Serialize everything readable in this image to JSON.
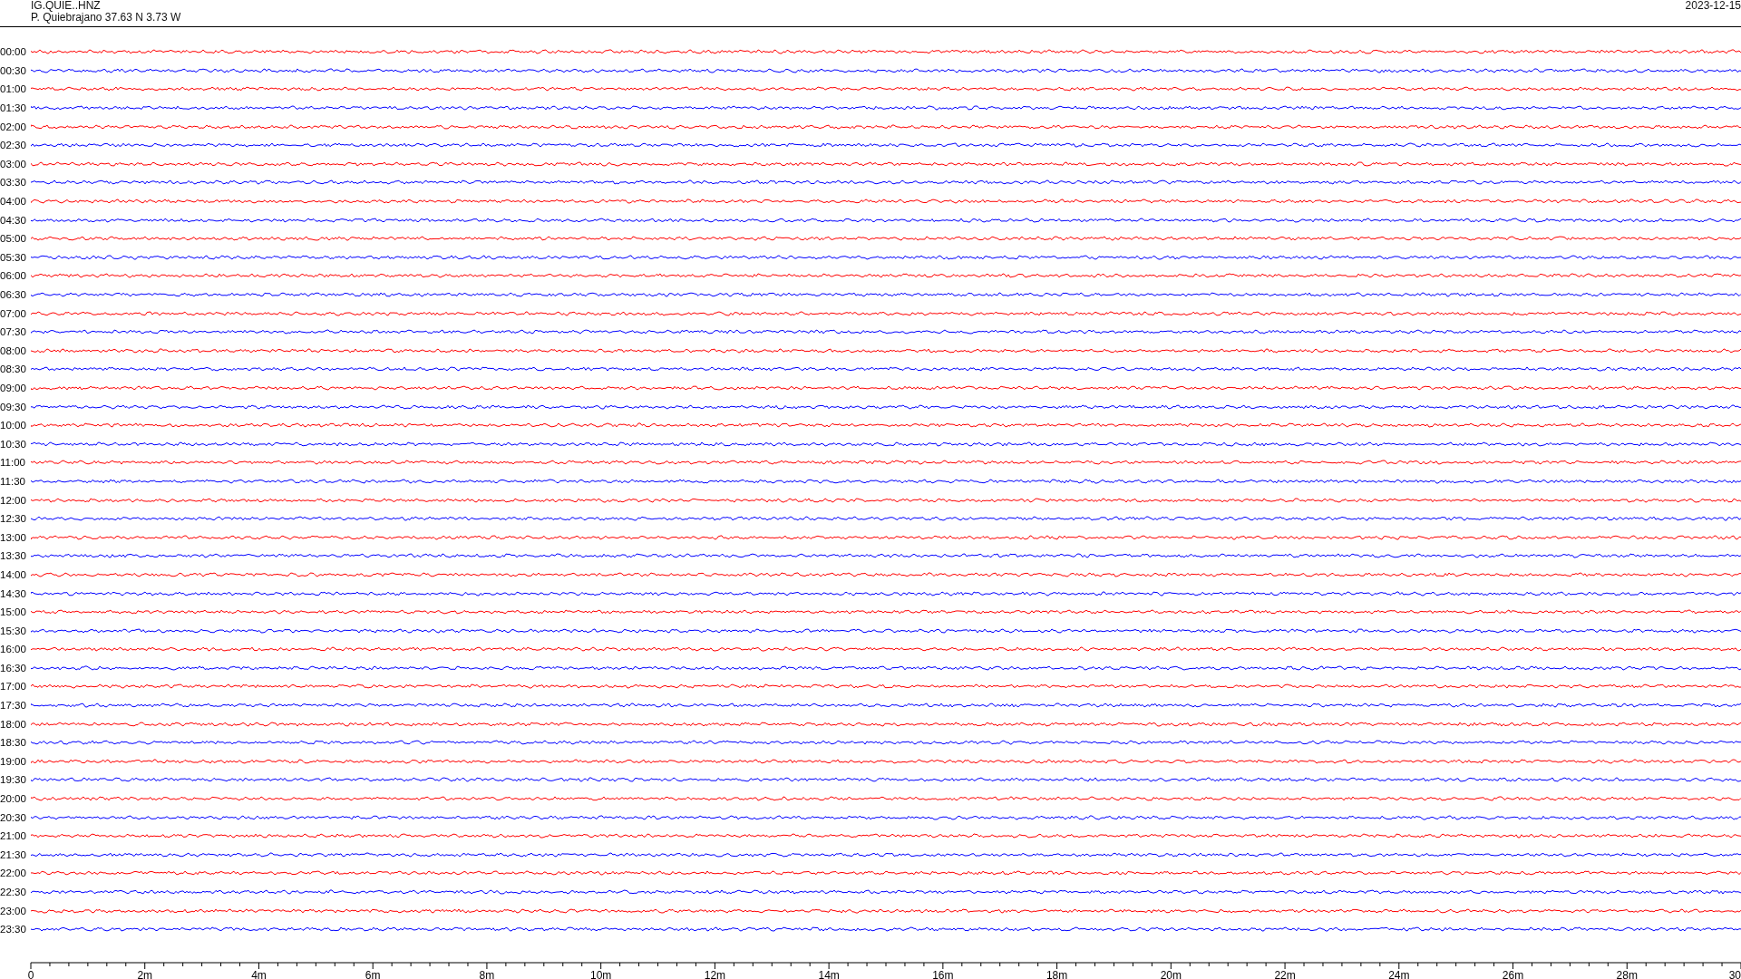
{
  "header": {
    "station": "IG.QUIE..HNZ",
    "location": "P. Quiebrajano  37.63 N 3.73 W",
    "date": "2023-12-15"
  },
  "traces": [
    {
      "label": "00:00",
      "color": "#ff0000"
    },
    {
      "label": "00:30",
      "color": "#0000ff"
    },
    {
      "label": "01:00",
      "color": "#ff0000"
    },
    {
      "label": "01:30",
      "color": "#0000ff"
    },
    {
      "label": "02:00",
      "color": "#ff0000"
    },
    {
      "label": "02:30",
      "color": "#0000ff"
    },
    {
      "label": "03:00",
      "color": "#ff0000"
    },
    {
      "label": "03:30",
      "color": "#0000ff"
    },
    {
      "label": "04:00",
      "color": "#ff0000"
    },
    {
      "label": "04:30",
      "color": "#0000ff"
    },
    {
      "label": "05:00",
      "color": "#ff0000"
    },
    {
      "label": "05:30",
      "color": "#0000ff"
    },
    {
      "label": "06:00",
      "color": "#ff0000"
    },
    {
      "label": "06:30",
      "color": "#0000ff"
    },
    {
      "label": "07:00",
      "color": "#ff0000"
    },
    {
      "label": "07:30",
      "color": "#0000ff"
    },
    {
      "label": "08:00",
      "color": "#ff0000"
    },
    {
      "label": "08:30",
      "color": "#0000ff"
    },
    {
      "label": "09:00",
      "color": "#ff0000"
    },
    {
      "label": "09:30",
      "color": "#0000ff"
    },
    {
      "label": "10:00",
      "color": "#ff0000"
    },
    {
      "label": "10:30",
      "color": "#0000ff"
    },
    {
      "label": "11:00",
      "color": "#ff0000"
    },
    {
      "label": "11:30",
      "color": "#0000ff"
    },
    {
      "label": "12:00",
      "color": "#ff0000"
    },
    {
      "label": "12:30",
      "color": "#0000ff"
    },
    {
      "label": "13:00",
      "color": "#ff0000"
    },
    {
      "label": "13:30",
      "color": "#0000ff"
    },
    {
      "label": "14:00",
      "color": "#ff0000"
    },
    {
      "label": "14:30",
      "color": "#0000ff"
    },
    {
      "label": "15:00",
      "color": "#ff0000"
    },
    {
      "label": "15:30",
      "color": "#0000ff"
    },
    {
      "label": "16:00",
      "color": "#ff0000"
    },
    {
      "label": "16:30",
      "color": "#0000ff"
    },
    {
      "label": "17:00",
      "color": "#ff0000"
    },
    {
      "label": "17:30",
      "color": "#0000ff"
    },
    {
      "label": "18:00",
      "color": "#ff0000"
    },
    {
      "label": "18:30",
      "color": "#0000ff"
    },
    {
      "label": "19:00",
      "color": "#ff0000"
    },
    {
      "label": "19:30",
      "color": "#0000ff"
    },
    {
      "label": "20:00",
      "color": "#ff0000"
    },
    {
      "label": "20:30",
      "color": "#0000ff"
    },
    {
      "label": "21:00",
      "color": "#ff0000"
    },
    {
      "label": "21:30",
      "color": "#0000ff"
    },
    {
      "label": "22:00",
      "color": "#ff0000"
    },
    {
      "label": "22:30",
      "color": "#0000ff"
    },
    {
      "label": "23:00",
      "color": "#ff0000"
    },
    {
      "label": "23:30",
      "color": "#0000ff"
    }
  ],
  "axis": {
    "ticks": [
      "0",
      "2m",
      "4m",
      "6m",
      "8m",
      "10m",
      "12m",
      "14m",
      "16m",
      "18m",
      "20m",
      "22m",
      "24m",
      "26m",
      "28m",
      "30"
    ]
  }
}
